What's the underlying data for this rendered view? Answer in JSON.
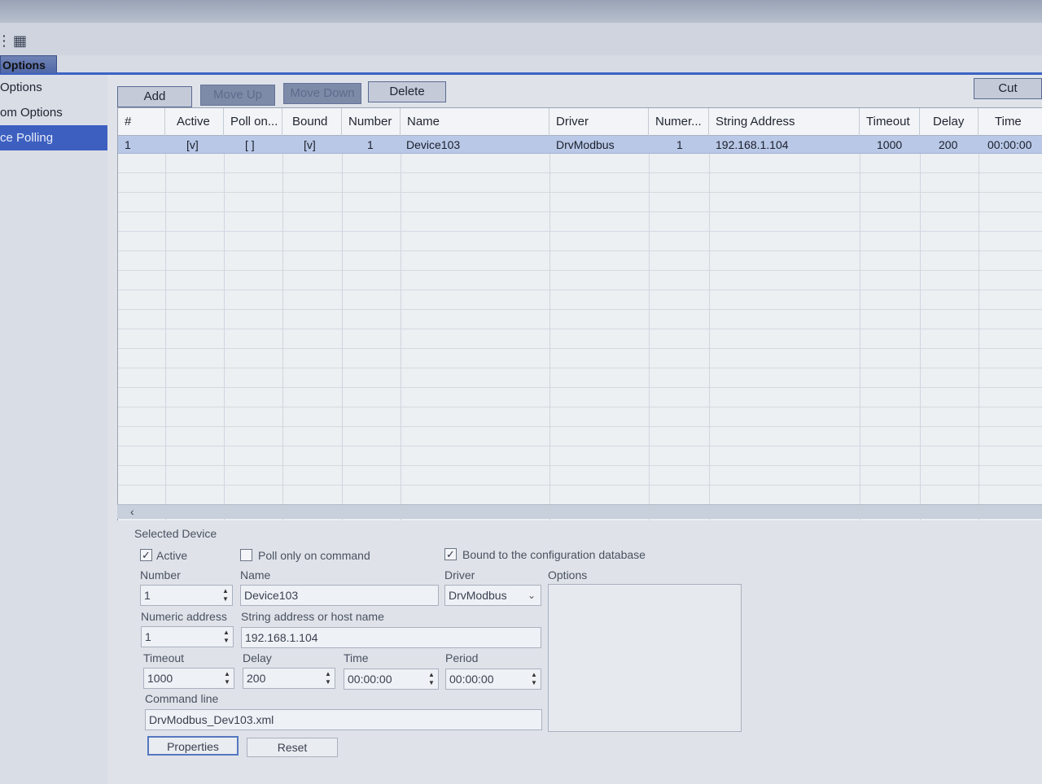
{
  "toolbar": {
    "icon_a": "grid-icon"
  },
  "tabs": {
    "active": "Options"
  },
  "sidebar": {
    "items": [
      {
        "label": "Options"
      },
      {
        "label": "om Options"
      },
      {
        "label": "ce Polling"
      }
    ]
  },
  "actions": {
    "add": "Add",
    "move_up": "Move Up",
    "move_down": "Move Down",
    "delete": "Delete",
    "cut": "Cut"
  },
  "grid": {
    "columns": [
      "#",
      "Active",
      "Poll on...",
      "Bound",
      "Number",
      "Name",
      "Driver",
      "Numer...",
      "String Address",
      "Timeout",
      "Delay",
      "Time"
    ],
    "rows": [
      [
        "1",
        "[v]",
        "[ ]",
        "[v]",
        "1",
        "Device103",
        "DrvModbus",
        "1",
        "192.168.1.104",
        "1000",
        "200",
        "00:00:00"
      ]
    ]
  },
  "selected": {
    "section_title": "Selected Device",
    "active_label": "Active",
    "active_checked": "✓",
    "poll_label": "Poll only on command",
    "poll_checked": "",
    "bound_label": "Bound to the configuration database",
    "bound_checked": "✓",
    "number_label": "Number",
    "number_value": "1",
    "name_label": "Name",
    "name_value": "Device103",
    "driver_label": "Driver",
    "driver_value": "DrvModbus",
    "options_label": "Options",
    "numeric_address_label": "Numeric address",
    "numeric_address_value": "1",
    "string_address_label": "String address or host name",
    "string_address_value": "192.168.1.104",
    "timeout_label": "Timeout",
    "timeout_value": "1000",
    "delay_label": "Delay",
    "delay_value": "200",
    "time_label": "Time",
    "time_value": "00:00:00",
    "period_label": "Period",
    "period_value": "00:00:00",
    "command_line_label": "Command line",
    "command_line_value": "DrvModbus_Dev103.xml",
    "properties_button": "Properties",
    "reset_button": "Reset"
  }
}
